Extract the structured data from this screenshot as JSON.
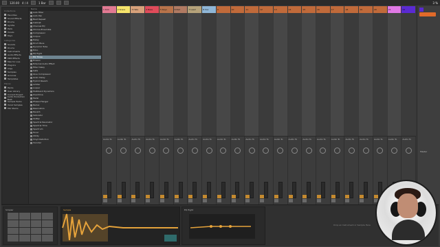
{
  "transport": {
    "tempo": "120.00",
    "time_sig": "4 / 4",
    "quantize": "1 Bar",
    "cpu": "3 %"
  },
  "browser": {
    "collections_header": "Collections",
    "categories_header": "Categories",
    "places_header": "Places",
    "collections": [
      "Favorites",
      "Sound Effects",
      "Drums",
      "Synths",
      "Pads",
      "Vocals",
      "Keys"
    ],
    "categories": [
      "Sounds",
      "Drums",
      "Instruments",
      "Audio Effects",
      "MIDI Effects",
      "Max for Live",
      "Plug-Ins",
      "Clips",
      "Samples",
      "Grooves",
      "Templates"
    ],
    "places": [
      "Packs",
      "User Library",
      "Current Project",
      "Audio Production Beat",
      "Sample Packs",
      "Vocal Samples",
      "Mix Stems"
    ],
    "items_header": "Name",
    "items": [
      "Auto Filter",
      "Auto Pan",
      "Beat Repeat",
      "Cabinet",
      "Channel EQ",
      "Chorus-Ensemble",
      "Compressor",
      "Corpus",
      "Delay",
      "Drum Buss",
      "Dynamic Tube",
      "Echo",
      "EQ Eight",
      "EQ Three",
      "Erosion",
      "External Audio Effect",
      "Filter Delay",
      "Gate",
      "Glue Compressor",
      "Grain Delay",
      "Hybrid Reverb",
      "Limiter",
      "Looper",
      "Multiband Dynamics",
      "Overdrive",
      "Pedal",
      "Phaser-Flanger",
      "Redux",
      "Resonators",
      "Reverb",
      "Saturator",
      "Shifter",
      "Spectral Resonator",
      "Spectral Time",
      "Spectrum",
      "Tuner",
      "Utility",
      "Vinyl Distortion",
      "Vocoder"
    ],
    "selected_index": 13
  },
  "tracks": [
    {
      "name": "1 Kick",
      "color": "#e27a93"
    },
    {
      "name": "2 Snare",
      "color": "#f6e46b"
    },
    {
      "name": "3 Hats",
      "color": "#d7a17a"
    },
    {
      "name": "4 Bass",
      "color": "#e04b5a"
    },
    {
      "name": "5 Keys",
      "color": "#b8734a"
    },
    {
      "name": "6 Pad",
      "color": "#b07a62"
    },
    {
      "name": "7 Lead",
      "color": "#b5a27a"
    },
    {
      "name": "8 Vox",
      "color": "#8fb6d6"
    },
    {
      "name": "9",
      "color": "#c06a3a"
    },
    {
      "name": "10",
      "color": "#c06a3a"
    },
    {
      "name": "11",
      "color": "#c06a3a"
    },
    {
      "name": "12",
      "color": "#c06a3a"
    },
    {
      "name": "13",
      "color": "#c06a3a"
    },
    {
      "name": "14",
      "color": "#c06a3a"
    },
    {
      "name": "15",
      "color": "#c06a3a"
    },
    {
      "name": "16",
      "color": "#c06a3a"
    },
    {
      "name": "17",
      "color": "#c06a3a"
    },
    {
      "name": "18",
      "color": "#c06a3a"
    },
    {
      "name": "19",
      "color": "#c06a3a"
    },
    {
      "name": "20",
      "color": "#c06a3a"
    },
    {
      "name": "21",
      "color": "#e079e5"
    },
    {
      "name": "22",
      "color": "#5a2ad2"
    }
  ],
  "mixer": {
    "master_label": "Master",
    "track_io": "Audio To",
    "master_out": "Main"
  },
  "device": {
    "simpler_title": "Simpler",
    "sample_name": "Sample",
    "eq_title": "EQ Eight",
    "drop_text": "Drop an Instrument or Sample Here"
  },
  "accent_colors": {
    "orange": "#c58a2f",
    "wave": "#e6a33b",
    "selection": "#6f8591"
  }
}
